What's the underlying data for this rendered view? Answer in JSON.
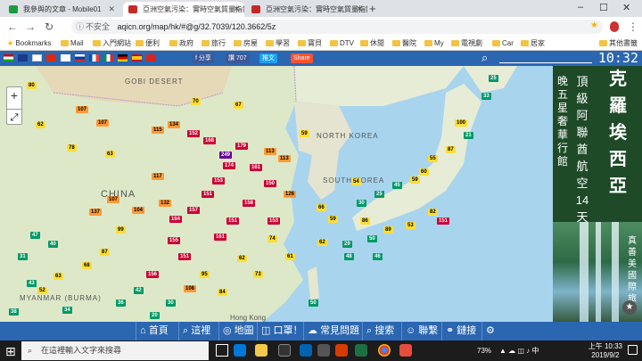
{
  "browser": {
    "tabs": [
      {
        "title": "我參與的文章 - Mobile01",
        "favicon_color": "#1a9c3e"
      },
      {
        "title": "亞洲空氣污染：實時空氣質量指數",
        "favicon_color": "#c62828"
      },
      {
        "title": "亞洲空氣污染：實時空氣質量指數",
        "favicon_color": "#c62828"
      }
    ],
    "new_tab": "+",
    "window_controls": [
      "–",
      "☐",
      "✕"
    ],
    "security_label": "不安全",
    "url": "aqicn.org/map/hk/#@g/32.7039/120.3662/5z",
    "bookmarks": [
      "Bookmarks",
      "Mail",
      "入門網站",
      "便利",
      "政府",
      "旅行",
      "房屋",
      "學習",
      "寶貝",
      "DTV",
      "休閒",
      "醫院",
      "My",
      "電視劇",
      "Car",
      "居家",
      "其他書籤"
    ]
  },
  "site": {
    "share_fb": "f 分享",
    "like_count": "讚 707",
    "share_tw": "推文",
    "share_more": "Share",
    "clock": "10:32",
    "map_labels": [
      "GOBI DESERT",
      "NORTH KOREA",
      "SOUTH KOREA",
      "CHINA",
      "MYANMAR (BURMA)",
      "Hong Kong"
    ],
    "zoom_in": "+",
    "zoom_out": "−",
    "fullscreen": "⤢",
    "ad_text_main": [
      "克",
      "羅",
      "埃",
      "西",
      "亞"
    ],
    "ad_text_side": [
      "頂",
      "級",
      "阿",
      "聯",
      "酋",
      "航",
      "空",
      "14",
      "天"
    ],
    "ad_text_side2": [
      "晚",
      "五",
      "星",
      "奢",
      "華",
      "行",
      "館"
    ],
    "ad_text_brand": [
      "真",
      "善",
      "美",
      "國",
      "際",
      "旅"
    ],
    "nav": [
      {
        "label": "首頁",
        "icon": "home-icon"
      },
      {
        "label": "這裡",
        "icon": "search-icon"
      },
      {
        "label": "地圖",
        "icon": "globe-icon"
      },
      {
        "label": "口罩！",
        "icon": "mask-icon"
      },
      {
        "label": "常見問題",
        "icon": "chat-icon"
      },
      {
        "label": "搜索",
        "icon": "search-icon"
      },
      {
        "label": "聯繫",
        "icon": "people-icon"
      },
      {
        "label": "鏈接",
        "icon": "link-icon"
      },
      {
        "label": "",
        "icon": "gear-icon"
      }
    ]
  },
  "aqi_markers": [
    {
      "v": "80",
      "c": "#ffde33"
    },
    {
      "v": "107",
      "c": "#ff9933"
    },
    {
      "v": "62",
      "c": "#ffde33"
    },
    {
      "v": "107",
      "c": "#ff9933"
    },
    {
      "v": "78",
      "c": "#ffde33"
    },
    {
      "v": "63",
      "c": "#ffde33"
    },
    {
      "v": "115",
      "c": "#ff9933"
    },
    {
      "v": "134",
      "c": "#ff9933"
    },
    {
      "v": "152",
      "c": "#cc0033"
    },
    {
      "v": "168",
      "c": "#cc0033"
    },
    {
      "v": "249",
      "c": "#660099"
    },
    {
      "v": "179",
      "c": "#cc0033"
    },
    {
      "v": "161",
      "c": "#cc0033"
    },
    {
      "v": "153",
      "c": "#cc0033"
    },
    {
      "v": "151",
      "c": "#cc0033"
    },
    {
      "v": "157",
      "c": "#cc0033"
    },
    {
      "v": "158",
      "c": "#cc0033"
    },
    {
      "v": "151",
      "c": "#cc0033"
    },
    {
      "v": "161",
      "c": "#cc0033"
    },
    {
      "v": "150",
      "c": "#cc0033"
    },
    {
      "v": "174",
      "c": "#cc0033"
    },
    {
      "v": "117",
      "c": "#ff9933"
    },
    {
      "v": "104",
      "c": "#ff9933"
    },
    {
      "v": "99",
      "c": "#ffde33"
    },
    {
      "v": "87",
      "c": "#ffde33"
    },
    {
      "v": "68",
      "c": "#ffde33"
    },
    {
      "v": "63",
      "c": "#ffde33"
    },
    {
      "v": "52",
      "c": "#ffde33"
    },
    {
      "v": "47",
      "c": "#009966"
    },
    {
      "v": "34",
      "c": "#009966"
    },
    {
      "v": "31",
      "c": "#009966"
    },
    {
      "v": "36",
      "c": "#009966"
    },
    {
      "v": "42",
      "c": "#009966"
    },
    {
      "v": "20",
      "c": "#009966"
    },
    {
      "v": "30",
      "c": "#009966"
    },
    {
      "v": "50",
      "c": "#009966"
    },
    {
      "v": "74",
      "c": "#ffde33"
    },
    {
      "v": "61",
      "c": "#ffde33"
    },
    {
      "v": "73",
      "c": "#ffde33"
    },
    {
      "v": "151",
      "c": "#cc0033"
    },
    {
      "v": "155",
      "c": "#cc0033"
    },
    {
      "v": "156",
      "c": "#cc0033"
    },
    {
      "v": "107",
      "c": "#ff9933"
    },
    {
      "v": "137",
      "c": "#ff9933"
    },
    {
      "v": "113",
      "c": "#ff9933"
    },
    {
      "v": "113",
      "c": "#ff9933"
    },
    {
      "v": "66",
      "c": "#ffde33"
    },
    {
      "v": "59",
      "c": "#ffde33"
    },
    {
      "v": "30",
      "c": "#009966"
    },
    {
      "v": "25",
      "c": "#009966"
    },
    {
      "v": "45",
      "c": "#009966"
    },
    {
      "v": "59",
      "c": "#ffde33"
    },
    {
      "v": "60",
      "c": "#ffde33"
    },
    {
      "v": "55",
      "c": "#ffde33"
    },
    {
      "v": "87",
      "c": "#ffde33"
    },
    {
      "v": "100",
      "c": "#ffde33"
    },
    {
      "v": "151",
      "c": "#cc0033"
    },
    {
      "v": "82",
      "c": "#ffde33"
    },
    {
      "v": "53",
      "c": "#ffde33"
    },
    {
      "v": "89",
      "c": "#ffde33"
    },
    {
      "v": "50",
      "c": "#009966"
    },
    {
      "v": "46",
      "c": "#009966"
    },
    {
      "v": "48",
      "c": "#009966"
    },
    {
      "v": "29",
      "c": "#009966"
    },
    {
      "v": "62",
      "c": "#ffde33"
    },
    {
      "v": "84",
      "c": "#ffde33"
    },
    {
      "v": "95",
      "c": "#ffde33"
    },
    {
      "v": "108",
      "c": "#ff9933"
    },
    {
      "v": "164",
      "c": "#cc0033"
    },
    {
      "v": "132",
      "c": "#ff9933"
    },
    {
      "v": "126",
      "c": "#ff9933"
    },
    {
      "v": "153",
      "c": "#cc0033"
    },
    {
      "v": "33",
      "c": "#009966"
    },
    {
      "v": "25",
      "c": "#009966"
    },
    {
      "v": "21",
      "c": "#009966"
    },
    {
      "v": "54",
      "c": "#ffde33"
    },
    {
      "v": "62",
      "c": "#ffde33"
    },
    {
      "v": "86",
      "c": "#ffde33"
    },
    {
      "v": "43",
      "c": "#009966"
    },
    {
      "v": "38",
      "c": "#009966"
    },
    {
      "v": "40",
      "c": "#009966"
    },
    {
      "v": "59",
      "c": "#ffde33"
    },
    {
      "v": "67",
      "c": "#ffde33"
    },
    {
      "v": "70",
      "c": "#ffde33"
    }
  ],
  "taskbar": {
    "search_placeholder": "在這裡輸入文字來搜尋",
    "battery": "73%",
    "time": "上午 10:33",
    "date": "2019/9/2"
  }
}
